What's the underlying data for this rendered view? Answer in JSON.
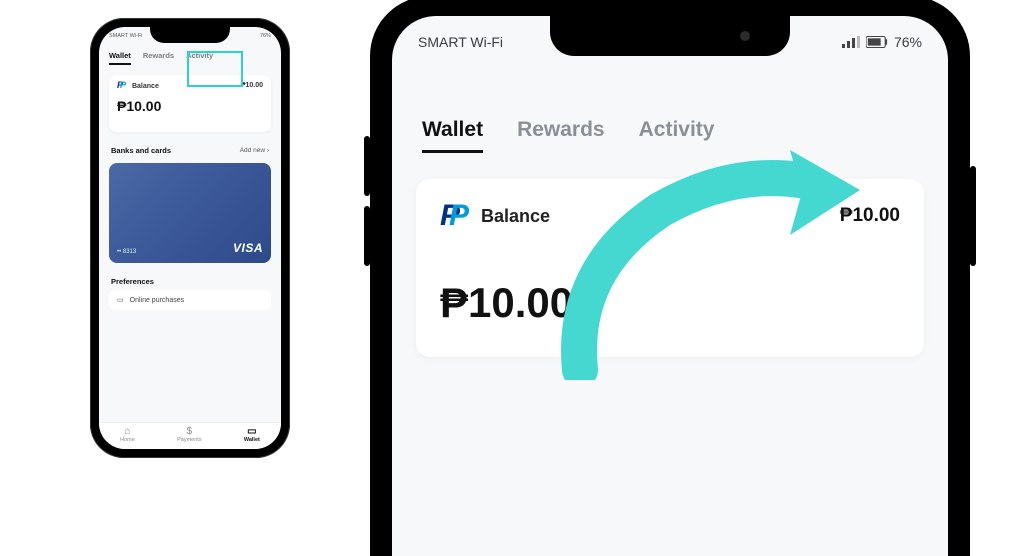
{
  "status": {
    "carrier": "SMART Wi-Fi",
    "battery": "76%"
  },
  "tabs": {
    "wallet": "Wallet",
    "rewards": "Rewards",
    "activity": "Activity"
  },
  "balance": {
    "label": "Balance",
    "amount_small": "₱10.00",
    "big_amount": "₱10.00",
    "card_right": "₱10.00"
  },
  "sections": {
    "banks": "Banks and cards",
    "add_new": "Add new ›",
    "preferences": "Preferences",
    "online_purchases": "Online purchases"
  },
  "card": {
    "masked": "•• 8313",
    "brand": "VISA"
  },
  "nav": {
    "home": "Home",
    "payments": "Payments",
    "wallet": "Wallet"
  }
}
